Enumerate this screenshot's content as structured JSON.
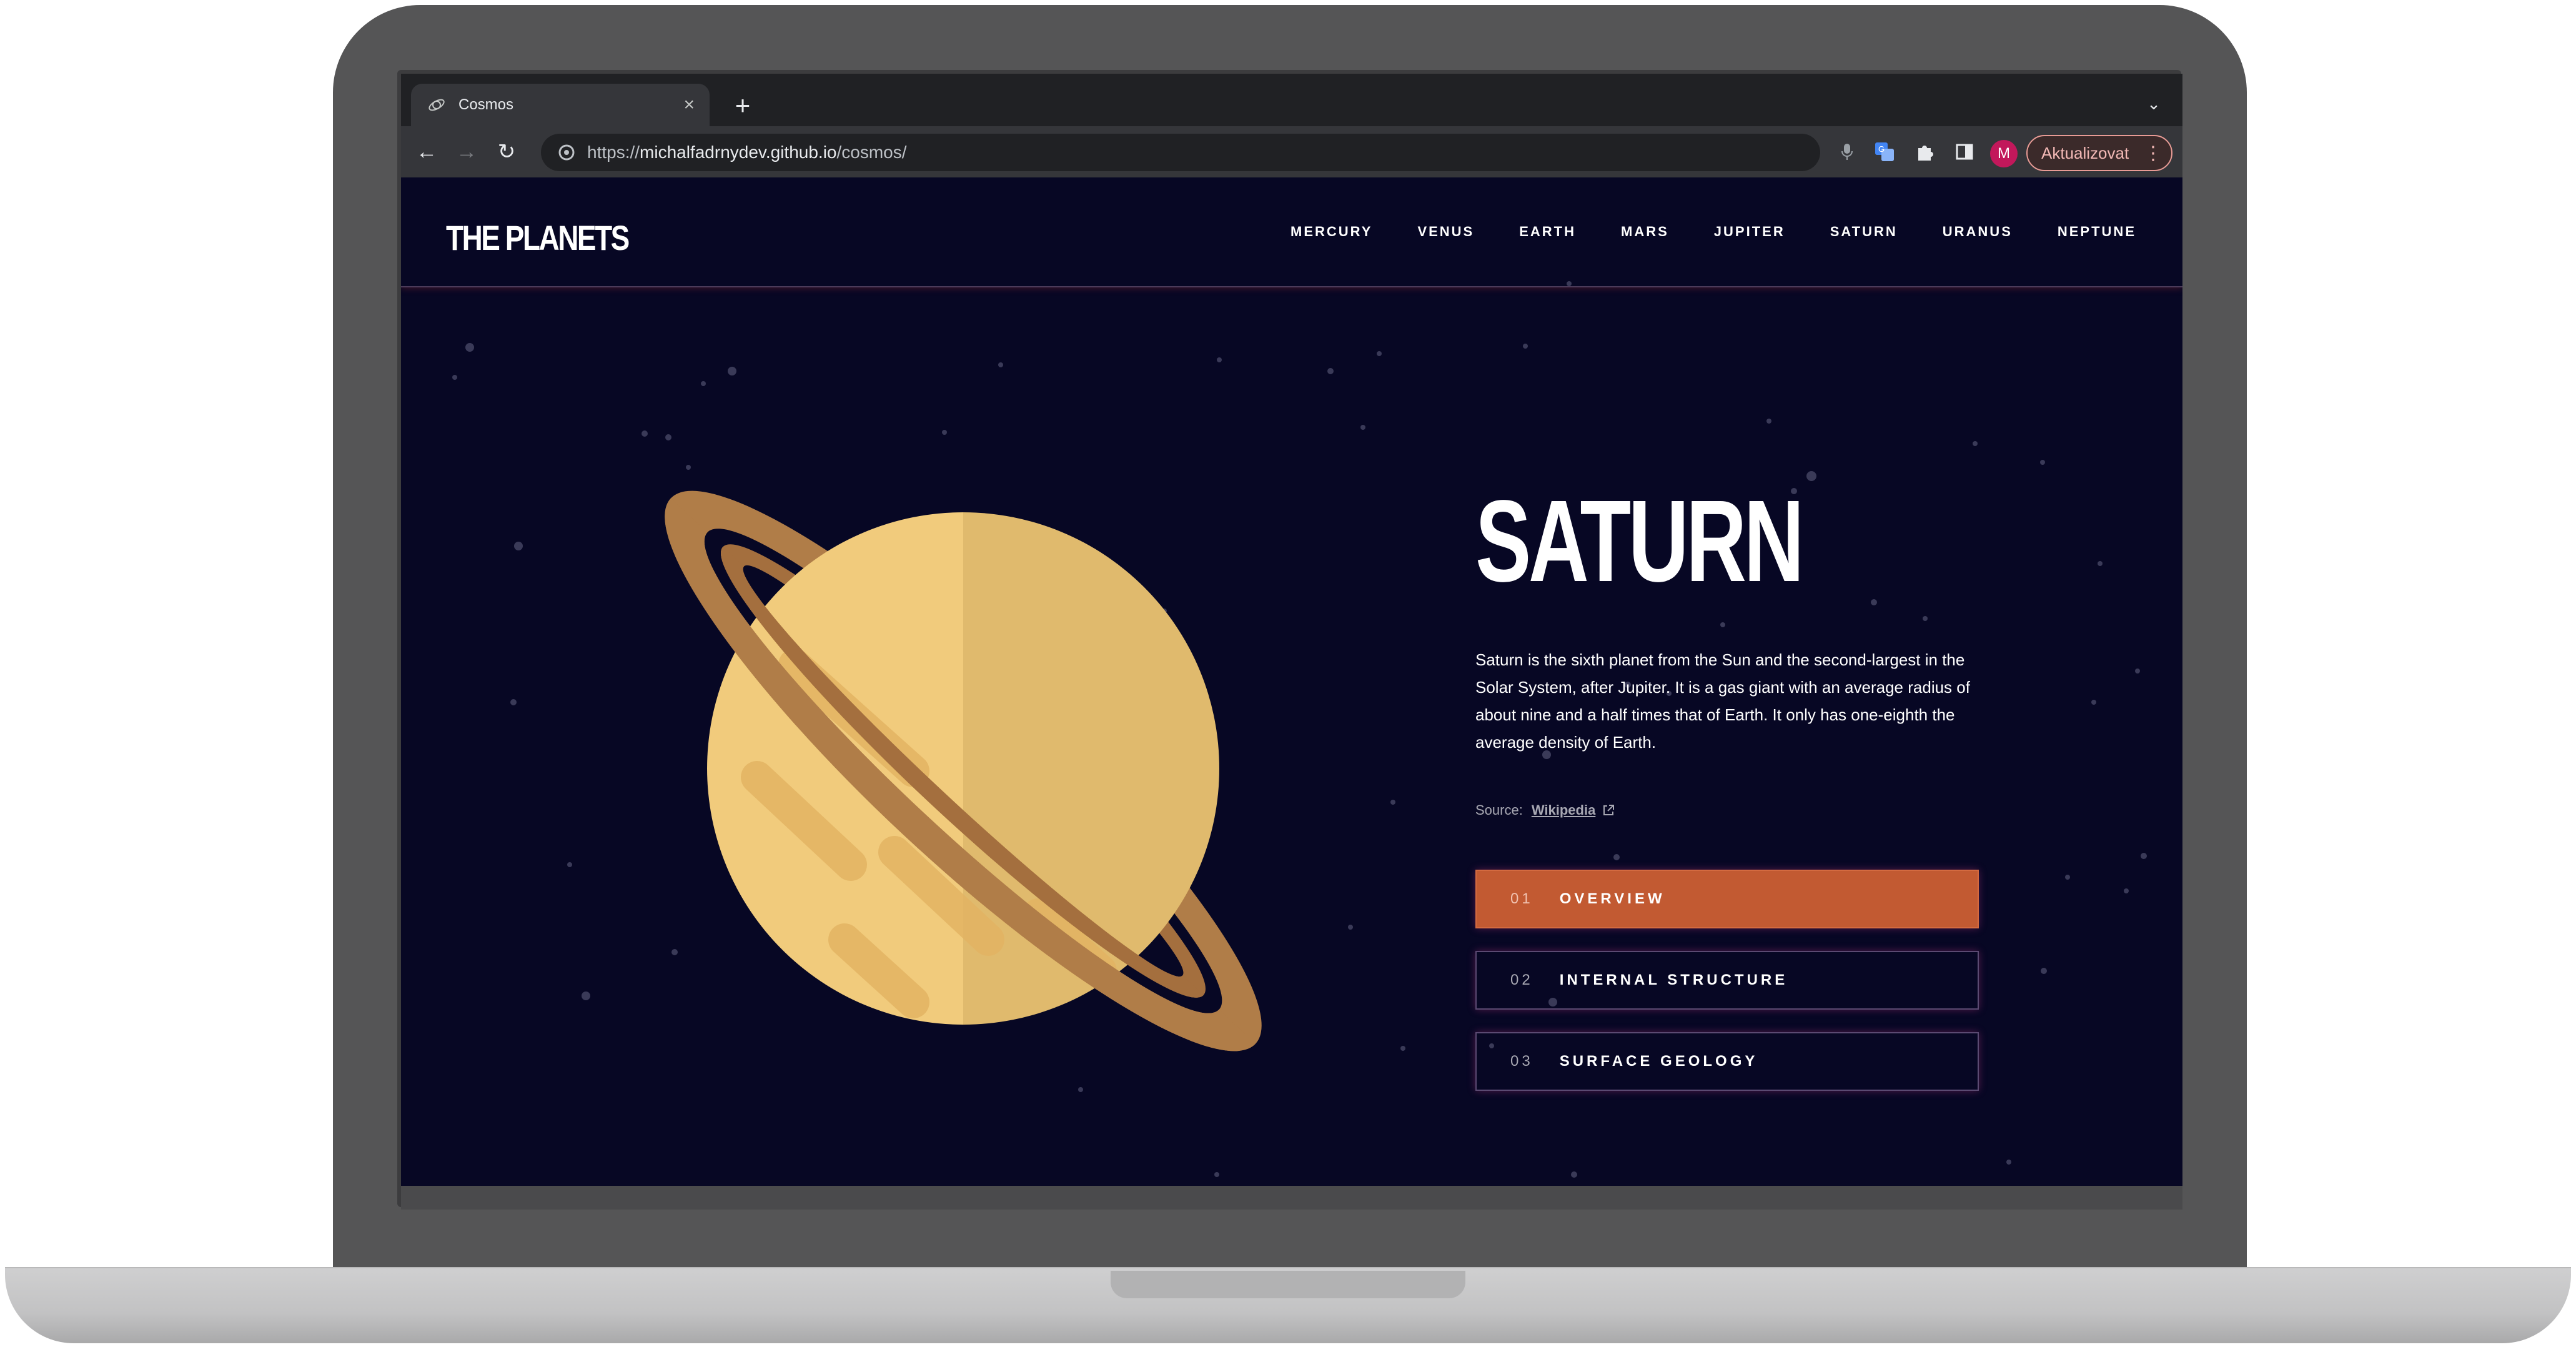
{
  "browser": {
    "tab_title": "Cosmos",
    "url_scheme": "https://",
    "url_host": "michalfadrnydev.github.io",
    "url_path": "/cosmos/",
    "profile_initial": "M",
    "update_label": "Aktualizovat"
  },
  "site": {
    "logo": "THE PLANETS",
    "nav": [
      "MERCURY",
      "VENUS",
      "EARTH",
      "MARS",
      "JUPITER",
      "SATURN",
      "URANUS",
      "NEPTUNE"
    ]
  },
  "planet": {
    "name": "SATURN",
    "description": "Saturn is the sixth planet from the Sun and the second-largest in the Solar System, after Jupiter. It is a gas giant with an average radius of about nine and a half times that of Earth. It only has one-eighth the average density of Earth.",
    "source_label": "Source:",
    "source_link": "Wikipedia"
  },
  "tabs": [
    {
      "num": "01",
      "label": "OVERVIEW",
      "active": true
    },
    {
      "num": "02",
      "label": "INTERNAL STRUCTURE",
      "active": false
    },
    {
      "num": "03",
      "label": "SURFACE GEOLOGY",
      "active": false
    }
  ],
  "colors": {
    "page_bg": "#070724",
    "accent": "#c25a32",
    "planet_light": "#f1cb7c",
    "planet_shade": "#e0ba6d",
    "ring": "#b07d48"
  }
}
